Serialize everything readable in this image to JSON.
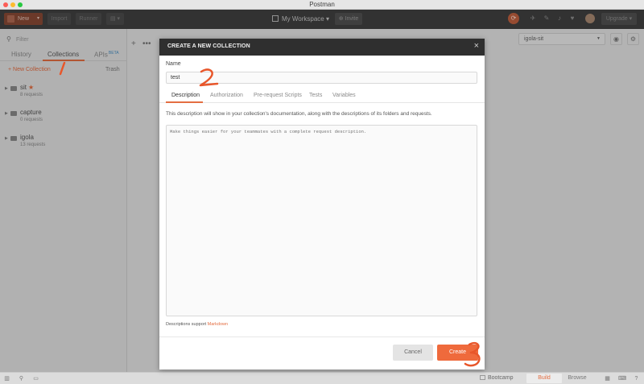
{
  "window": {
    "title": "Postman"
  },
  "header": {
    "new_label": "New",
    "import_label": "Import",
    "runner_label": "Runner",
    "workspace_label": "My Workspace",
    "invite_label": "Invite",
    "upgrade_label": "Upgrade"
  },
  "sidebar": {
    "filter_placeholder": "Filter",
    "tabs": [
      "History",
      "Collections",
      "APIs"
    ],
    "apis_badge": "BETA",
    "new_collection_label": "New Collection",
    "trash_label": "Trash",
    "collections": [
      {
        "name": "sit",
        "count": "8 requests",
        "starred": true
      },
      {
        "name": "capture",
        "count": "0 requests",
        "starred": false
      },
      {
        "name": "igola",
        "count": "13 requests",
        "starred": false
      }
    ]
  },
  "environment": {
    "selected": "igola-sit"
  },
  "modal": {
    "title": "CREATE A NEW COLLECTION",
    "name_label": "Name",
    "name_value": "test",
    "tabs": [
      "Description",
      "Authorization",
      "Pre-request Scripts",
      "Tests",
      "Variables"
    ],
    "active_tab": "Description",
    "description_help": "This description will show in your collection's documentation, along with the descriptions of its folders and requests.",
    "description_placeholder": "Make things easier for your teammates with a complete request description.",
    "markdown_prefix": "Descriptions support",
    "markdown_link": "Markdown",
    "cancel_label": "Cancel",
    "create_label": "Create"
  },
  "statusbar": {
    "bootcamp_label": "Bootcamp",
    "build_label": "Build",
    "browse_label": "Browse"
  },
  "colors": {
    "accent": "#e46e42",
    "header_bg": "#414141",
    "modal_header_bg": "#2f2f2f",
    "create_button": "#ef6a3c"
  }
}
